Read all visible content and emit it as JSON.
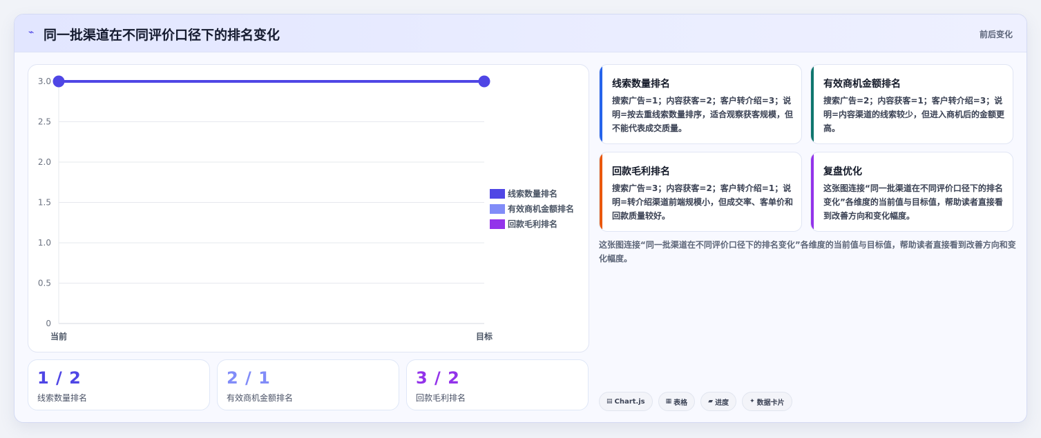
{
  "header": {
    "icon": "wave-icon",
    "title": "同一批渠道在不同评价口径下的排名变化",
    "right_label": "前后变化"
  },
  "chart_data": {
    "type": "line",
    "title": "",
    "xlabel": "",
    "ylabel": "",
    "categories": [
      "当前",
      "目标"
    ],
    "ylim": [
      0,
      3.0
    ],
    "yticks": [
      "0",
      "0.5",
      "1.0",
      "1.5",
      "2.0",
      "2.5",
      "3.0"
    ],
    "grid": true,
    "legend_position": "right",
    "series": [
      {
        "name": "线索数量排名",
        "values": [
          3,
          3
        ],
        "color": "#4f46e5"
      },
      {
        "name": "有效商机金额排名",
        "values": [
          3,
          3
        ],
        "color": "#818cf8"
      },
      {
        "name": "回款毛利排名",
        "values": [
          3,
          3
        ],
        "color": "#9333ea"
      }
    ]
  },
  "stats": [
    {
      "value": "1 / 2",
      "label": "线索数量排名",
      "color": "#4f46e5"
    },
    {
      "value": "2 / 1",
      "label": "有效商机金额排名",
      "color": "#818cf8"
    },
    {
      "value": "3 / 2",
      "label": "回款毛利排名",
      "color": "#9333ea"
    }
  ],
  "info_cards": [
    {
      "title": "线索数量排名",
      "body": "搜索广告=1；内容获客=2；客户转介绍=3；说明=按去重线索数量排序，适合观察获客规模，但不能代表成交质量。",
      "color": "#2563eb"
    },
    {
      "title": "有效商机金额排名",
      "body": "搜索广告=2；内容获客=1；客户转介绍=3；说明=内容渠道的线索较少，但进入商机后的金额更高。",
      "color": "#0f766e"
    },
    {
      "title": "回款毛利排名",
      "body": "搜索广告=3；内容获客=2；客户转介绍=1；说明=转介绍渠道前端规模小，但成交率、客单价和回款质量较好。",
      "color": "#ea580c"
    },
    {
      "title": "复盘优化",
      "body": "这张图连接“同一批渠道在不同评价口径下的排名变化”各维度的当前值与目标值，帮助读者直接看到改善方向和变化幅度。",
      "color": "#9333ea"
    }
  ],
  "description": "这张图连接“同一批渠道在不同评价口径下的排名变化”各维度的当前值与目标值，帮助读者直接看到改善方向和变化幅度。",
  "tags": [
    {
      "icon": "chart-icon",
      "glyph": "▤",
      "label": "Chart.js"
    },
    {
      "icon": "table-icon",
      "glyph": "▦",
      "label": "表格"
    },
    {
      "icon": "progress-icon",
      "glyph": "▰",
      "label": "进度"
    },
    {
      "icon": "sparkle-icon",
      "glyph": "✦",
      "label": "数据卡片"
    }
  ]
}
